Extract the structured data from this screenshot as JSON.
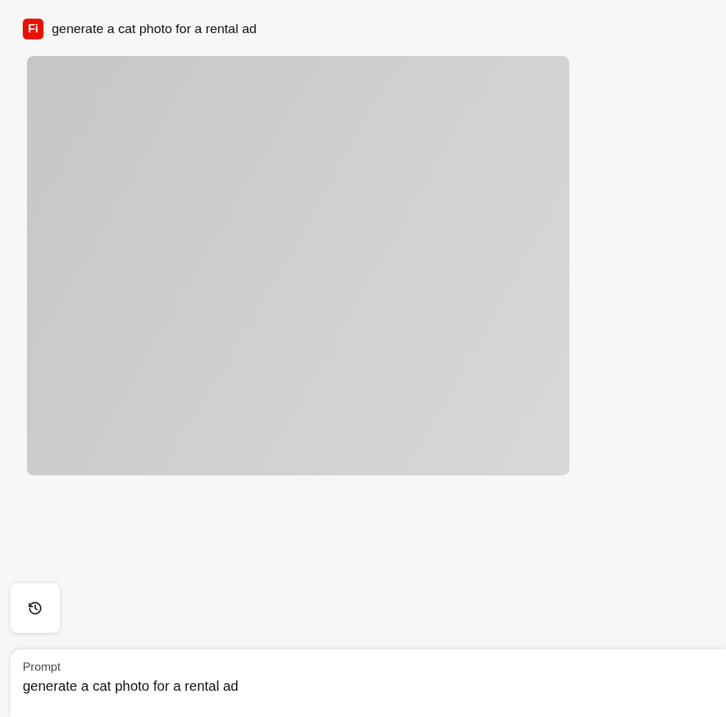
{
  "header": {
    "app_logo": "Fi",
    "prompt_title": "generate a cat photo for a rental ad"
  },
  "result": {
    "kind": "placeholder"
  },
  "history_button": {
    "kind": "history"
  },
  "prompt": {
    "label": "Prompt",
    "value": "generate a cat photo for a rental ad"
  }
}
